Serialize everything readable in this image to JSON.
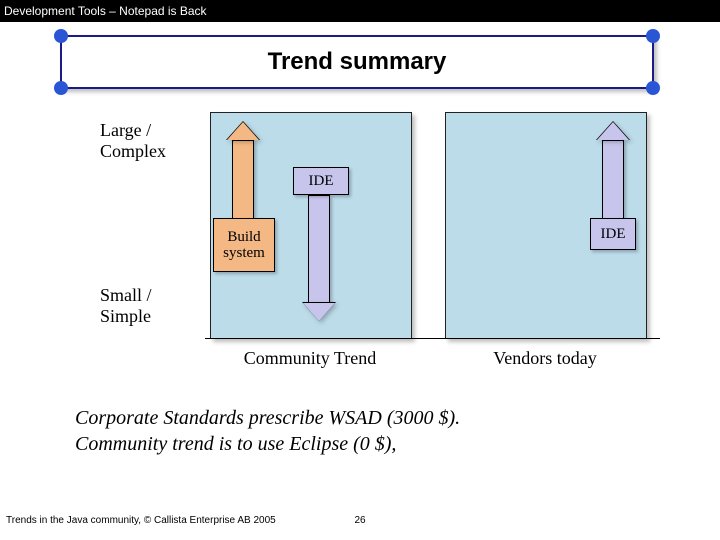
{
  "header": {
    "title": "Development Tools – Notepad is Back"
  },
  "title": "Trend summary",
  "axes": {
    "y_top": "Large / Complex",
    "y_bottom": "Small / Simple",
    "x_left": "Community Trend",
    "x_right": "Vendors today"
  },
  "boxes": {
    "build_system": "Build system",
    "ide_left": "IDE",
    "ide_right": "IDE"
  },
  "chart_data": {
    "type": "diagram",
    "y_axis": [
      "Small / Simple",
      "Large / Complex"
    ],
    "categories": [
      "Community Trend",
      "Vendors today"
    ],
    "series": [
      {
        "name": "Build system",
        "category": "Community Trend",
        "direction": "up",
        "color": "#f4b884"
      },
      {
        "name": "IDE",
        "category": "Community Trend",
        "direction": "down",
        "color": "#c7c5ec"
      },
      {
        "name": "IDE",
        "category": "Vendors today",
        "direction": "up",
        "color": "#c7c5ec"
      }
    ],
    "title": "Trend summary"
  },
  "body": {
    "line1": "Corporate Standards prescribe WSAD (3000 $).",
    "line2": "Community trend is to use Eclipse (0 $),"
  },
  "footer": {
    "left": "Trends in the Java community, © Callista Enterprise AB 2005",
    "page": "26"
  }
}
